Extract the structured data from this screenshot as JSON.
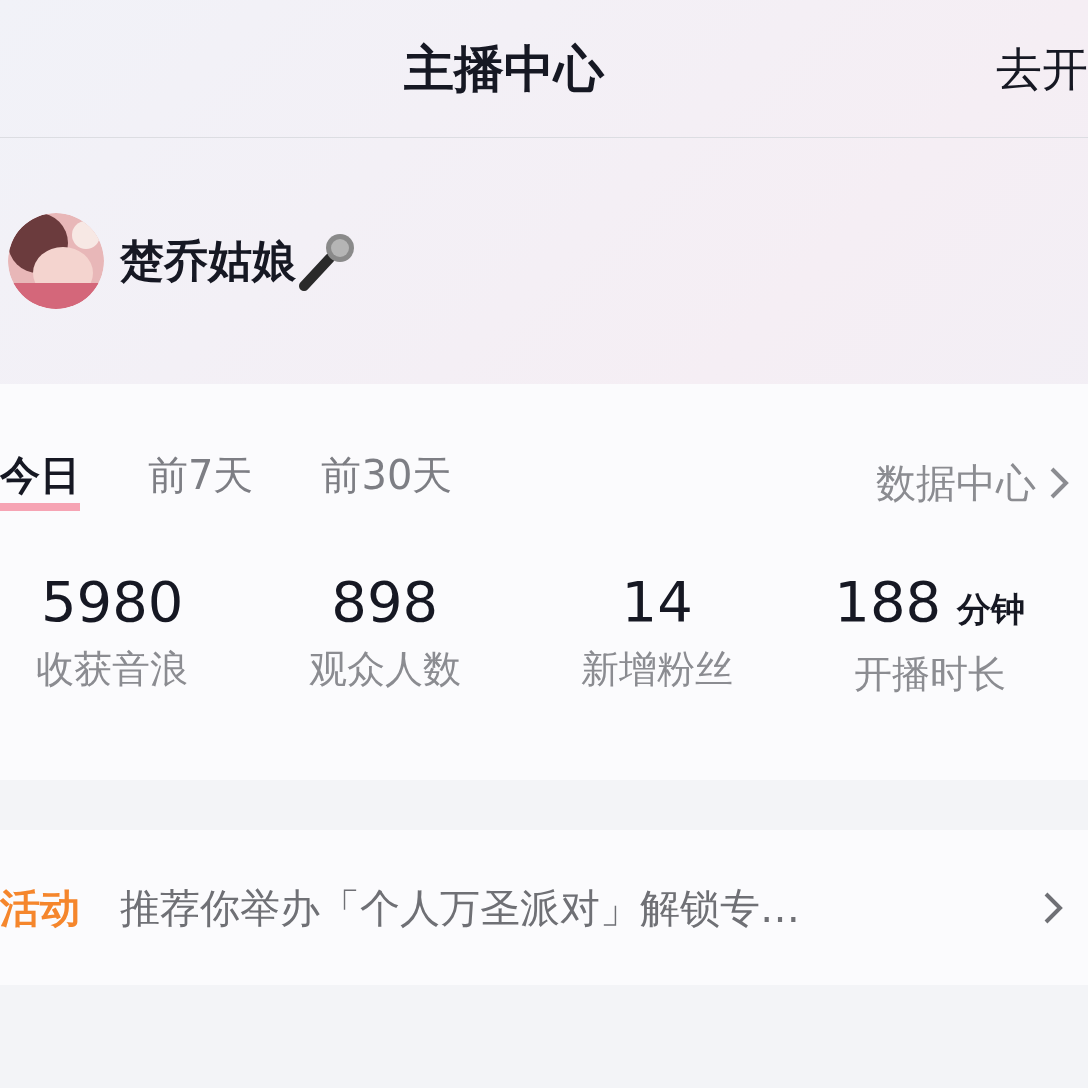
{
  "header": {
    "title": "主播中心",
    "action": "去开"
  },
  "profile": {
    "name": "楚乔姑娘"
  },
  "tabs": [
    {
      "label": "今日",
      "selected": true
    },
    {
      "label": "前7天",
      "selected": false
    },
    {
      "label": "前30天",
      "selected": false
    }
  ],
  "data_link": "数据中心",
  "stats": [
    {
      "value": "5980",
      "label": "收获音浪"
    },
    {
      "value": "898",
      "label": "观众人数"
    },
    {
      "value": "14",
      "label": "新增粉丝"
    },
    {
      "value": "188",
      "unit": "分钟",
      "label": "开播时长"
    }
  ],
  "activity": {
    "tag": "活动",
    "text": "推荐你举办「个人万圣派对」解锁专…"
  }
}
